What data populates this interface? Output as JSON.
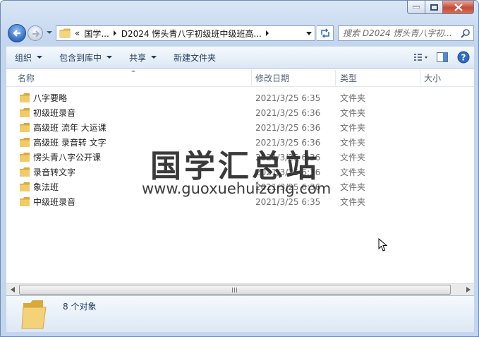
{
  "window": {
    "caption_buttons": [
      "minimize",
      "maximize",
      "close"
    ]
  },
  "address": {
    "overflow_marker": "«",
    "crumbs": [
      {
        "label": "国学..."
      },
      {
        "label": "D2024 愣头青八字初级班中级班高..."
      }
    ]
  },
  "search": {
    "placeholder": "搜索 D2024 愣头青八字初..."
  },
  "commands": {
    "organize": "组织",
    "include_in_library": "包含到库中",
    "share": "共享",
    "new_folder": "新建文件夹"
  },
  "columns": {
    "name": "名称",
    "date_modified": "修改日期",
    "type": "类型",
    "size": "大小"
  },
  "files": [
    {
      "name": "八字要略",
      "date": "2021/3/25 6:35",
      "type": "文件夹"
    },
    {
      "name": "初级班录音",
      "date": "2021/3/25 6:36",
      "type": "文件夹"
    },
    {
      "name": "高级班 流年 大运课",
      "date": "2021/3/25 6:36",
      "type": "文件夹"
    },
    {
      "name": "高级班 录音转 文字",
      "date": "2021/3/25 6:36",
      "type": "文件夹"
    },
    {
      "name": "愣头青八字公开课",
      "date": "2021/3/25 6:36",
      "type": "文件夹"
    },
    {
      "name": "录音转文字",
      "date": "2021/3/25 6:36",
      "type": "文件夹"
    },
    {
      "name": "象法班",
      "date": "2021/3/25 6:36",
      "type": "文件夹"
    },
    {
      "name": "中级班录音",
      "date": "2021/3/25 6:35",
      "type": "文件夹"
    }
  ],
  "watermark": {
    "title": "国学汇总站",
    "url": "www.guoxuehuizong.com"
  },
  "status": {
    "item_count": "8 个对象"
  },
  "colors": {
    "folder": "#e8c35a",
    "chrome": "#c3d6ee",
    "accent_text": "#1e395b"
  }
}
